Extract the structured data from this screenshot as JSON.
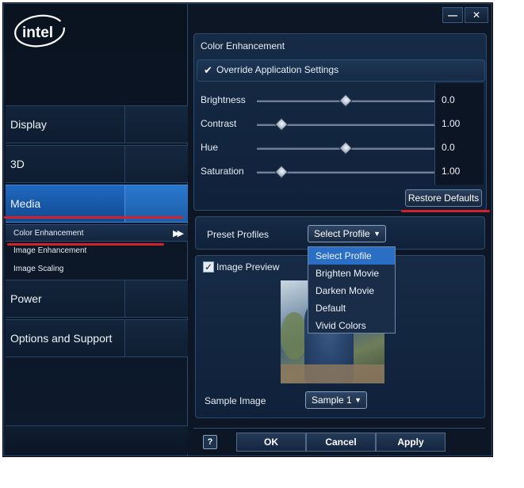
{
  "window": {
    "brand": "intel",
    "minimize_icon": "minimize-icon",
    "close_icon": "close-icon"
  },
  "nav": {
    "items": [
      {
        "label": "Display",
        "active": false
      },
      {
        "label": "3D",
        "active": false
      },
      {
        "label": "Media",
        "active": true
      },
      {
        "label": "Power",
        "active": false
      },
      {
        "label": "Options and Support",
        "active": false
      }
    ],
    "sub_items": [
      {
        "label": "Color Enhancement",
        "active": true,
        "icon": "double-chevron-right-icon"
      },
      {
        "label": "Image Enhancement",
        "active": false
      },
      {
        "label": "Image Scaling",
        "active": false
      }
    ]
  },
  "color_enhancement": {
    "title": "Color Enhancement",
    "override_label": "Override Application Settings",
    "override_checked": true,
    "sliders": [
      {
        "label": "Brightness",
        "value": "0.0",
        "position_fraction": 0.5
      },
      {
        "label": "Contrast",
        "value": "1.00",
        "position_fraction": 0.14
      },
      {
        "label": "Hue",
        "value": "0.0",
        "position_fraction": 0.5
      },
      {
        "label": "Saturation",
        "value": "1.00",
        "position_fraction": 0.14
      }
    ],
    "restore_defaults_label": "Restore Defaults"
  },
  "preset_profiles": {
    "label": "Preset Profiles",
    "selected": "Select Profile",
    "options": [
      "Select Profile",
      "Brighten Movie",
      "Darken Movie",
      "Default",
      "Vivid Colors"
    ]
  },
  "image_preview": {
    "label": "Image Preview",
    "checked": true,
    "sample_label": "Sample Image",
    "sample_selected": "Sample 1"
  },
  "footer": {
    "help_label": "?",
    "ok_label": "OK",
    "cancel_label": "Cancel",
    "apply_label": "Apply"
  },
  "colors": {
    "accent_blue": "#1f6ac2",
    "annotation_red": "#d6202c",
    "background": "#0d1624"
  }
}
